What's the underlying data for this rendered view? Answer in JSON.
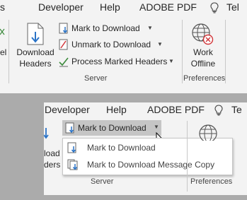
{
  "panel1": {
    "tabs": [
      "Developer",
      "Help",
      "ADOBE PDF",
      "Tel"
    ],
    "left_partial_label": "el",
    "download_headers_label_1": "Download",
    "download_headers_label_2": "Headers",
    "menu": [
      {
        "label": "Mark to Download",
        "icon": "mark-download-icon"
      },
      {
        "label": "Unmark to Download",
        "icon": "unmark-download-icon"
      },
      {
        "label": "Process Marked Headers",
        "icon": "process-headers-icon"
      }
    ],
    "work_offline_1": "Work",
    "work_offline_2": "Offline",
    "group_server": "Server",
    "group_preferences": "Preferences"
  },
  "panel2": {
    "tabs": [
      "Developer",
      "Help",
      "ADOBE PDF",
      "Te"
    ],
    "partial_left_1": "load",
    "partial_left_2": "ders",
    "split_button_label": "Mark to Download",
    "dropdown": [
      {
        "label": "Mark to Download",
        "icon": "mark-download-icon"
      },
      {
        "label": "Mark to Download Message Copy",
        "icon": "mark-download-copy-icon"
      }
    ],
    "group_server": "Server",
    "group_preferences": "Preferences"
  },
  "colors": {
    "ribbon_bg": "#f3f3f3",
    "backdrop": "#ababab",
    "hover_bg": "#c5c5c5",
    "icon_blue": "#2a73c7",
    "icon_red": "#d13438",
    "icon_green": "#3c8a3c"
  }
}
